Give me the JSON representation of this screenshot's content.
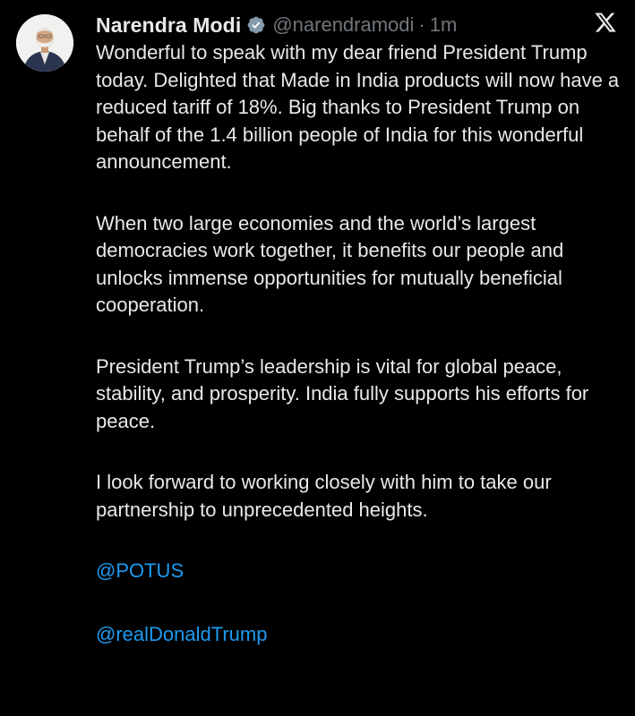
{
  "author": {
    "name": "Narendra Modi",
    "handle": "@narendramodi",
    "separator": "·",
    "time": "1m",
    "verified_icon": "verified-badge-icon"
  },
  "platform_icon": "x-logo-icon",
  "colors": {
    "background": "#000000",
    "text": "#e7e9ea",
    "muted": "#71767b",
    "link": "#1d9bf0",
    "verified": "#829aab"
  },
  "tweet": {
    "paragraphs": [
      "Wonderful to speak with my dear friend President Trump today. Delighted that Made in India products will now have a reduced tariff of 18%. Big thanks to President Trump on behalf of the 1.4 billion people of India for this wonderful announcement.",
      "When two large economies and the world’s largest democracies work together, it benefits our people and unlocks immense opportunities for mutually beneficial cooperation.",
      "President Trump’s leadership is vital for global peace, stability, and prosperity. India fully supports his efforts for peace.",
      "I look forward to working closely with him to take our partnership to unprecedented heights."
    ],
    "mentions": [
      "@POTUS",
      "@realDonaldTrump"
    ]
  }
}
